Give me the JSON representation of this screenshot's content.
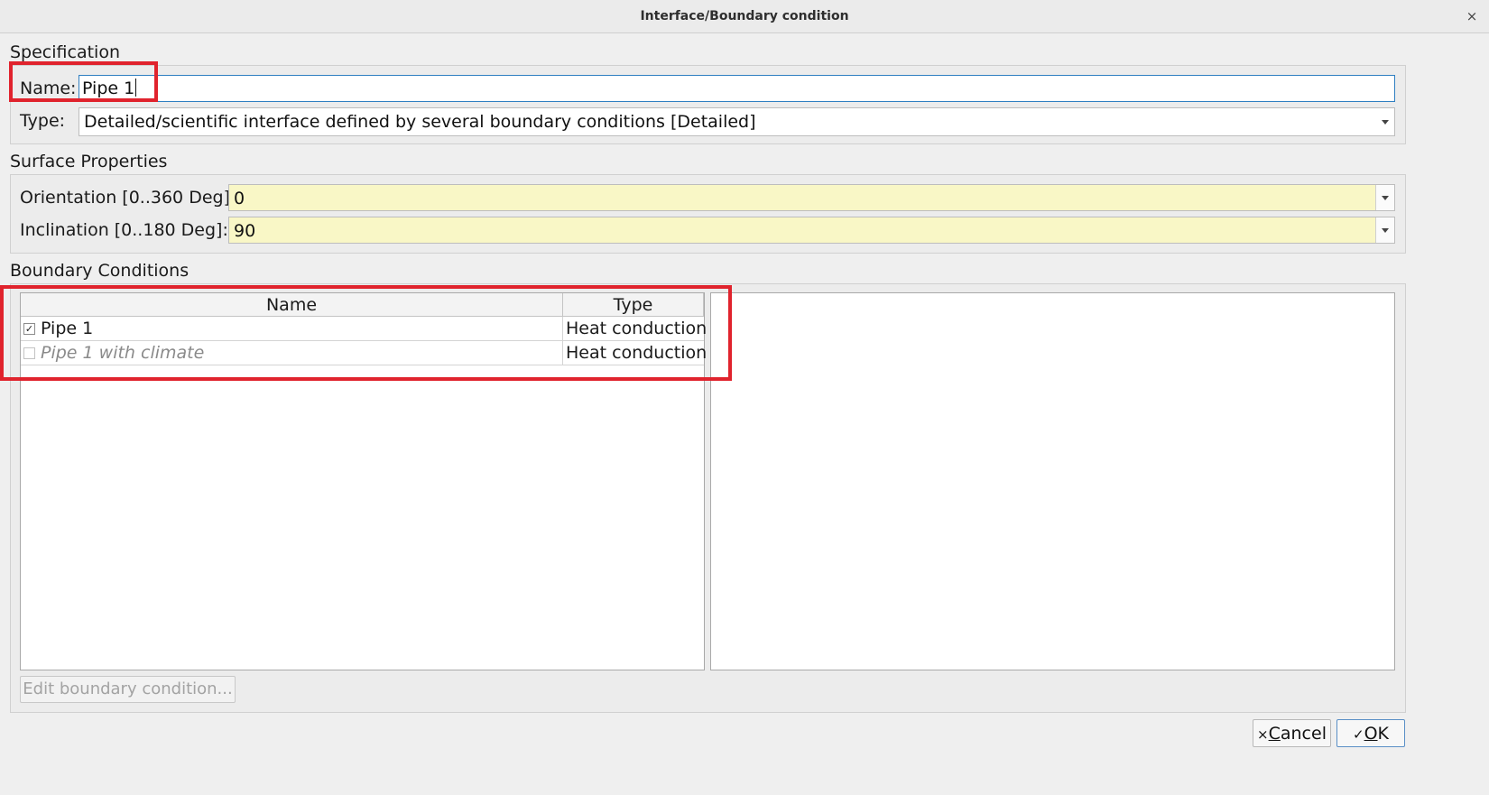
{
  "window": {
    "title": "Interface/Boundary condition",
    "close_glyph": "×"
  },
  "specification": {
    "section_label": "Specification",
    "name_label": "Name:",
    "name_value": "Pipe 1",
    "type_label": "Type:",
    "type_value": "Detailed/scientific interface defined by several boundary conditions [Detailed]"
  },
  "surface": {
    "section_label": "Surface Properties",
    "orientation_label": "Orientation [0..360 Deg]:",
    "orientation_value": "0",
    "inclination_label": "Inclination [0..180 Deg]:",
    "inclination_value": "90"
  },
  "boundary": {
    "section_label": "Boundary Conditions",
    "columns": [
      "Name",
      "Type"
    ],
    "rows": [
      {
        "name": "Pipe 1",
        "type": "Heat conduction",
        "checked": true,
        "check_glyph": "✓"
      },
      {
        "name": "Pipe 1 with climate",
        "type": "Heat conduction",
        "checked": false,
        "check_glyph": ""
      }
    ],
    "edit_button": "Edit boundary condition..."
  },
  "buttons": {
    "cancel_icon": "×",
    "cancel_mnemonic": "C",
    "cancel_rest": "ancel",
    "ok_icon": "✓",
    "ok_mnemonic": "O",
    "ok_rest": "K"
  },
  "colors": {
    "highlight": "#e0232d",
    "field_yellow": "#f9f7c6",
    "focus_border": "#2f7fc1"
  }
}
